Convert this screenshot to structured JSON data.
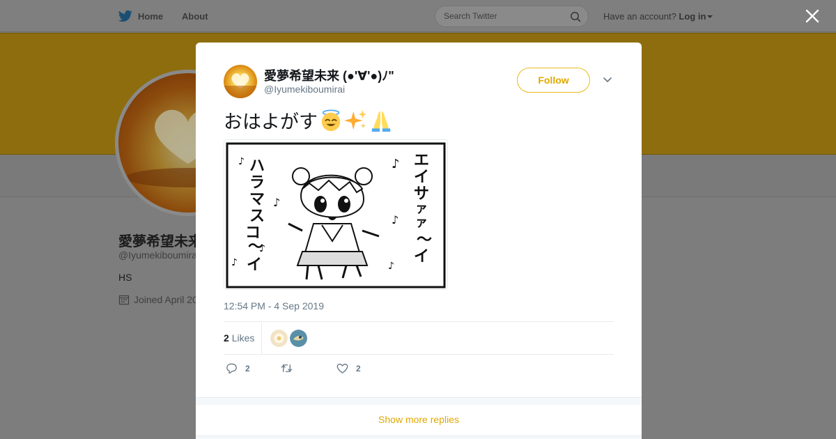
{
  "topbar": {
    "home_label": "Home",
    "about_label": "About",
    "search_placeholder": "Search Twitter",
    "account_prompt": "Have an account?",
    "login_label": "Log in"
  },
  "profile": {
    "name": "愛夢希望未来",
    "handle": "@Iyumekiboumirai",
    "bio": "HS",
    "joined": "Joined April 20"
  },
  "tweet": {
    "author_name": "愛夢希望未来 (●'∀'●)ﾉ\"",
    "author_handle": "@Iyumekiboumirai",
    "follow_label": "Follow",
    "text": "おはよがす",
    "emojis": [
      "smiling-face-with-halo",
      "sparkles",
      "folded-hands"
    ],
    "image_alt": "manga drawing of a girl singing",
    "timestamp": "12:54 PM - 4 Sep 2019",
    "likes_count": "2",
    "likes_label": "Likes",
    "reply_count": "2",
    "retweet_count": "",
    "like_count": "2"
  },
  "show_more_replies": "Show more replies",
  "colors": {
    "accent": "#e0a800",
    "overlay_bg": "#7d7d7d",
    "banner": "#8e6d0e"
  }
}
